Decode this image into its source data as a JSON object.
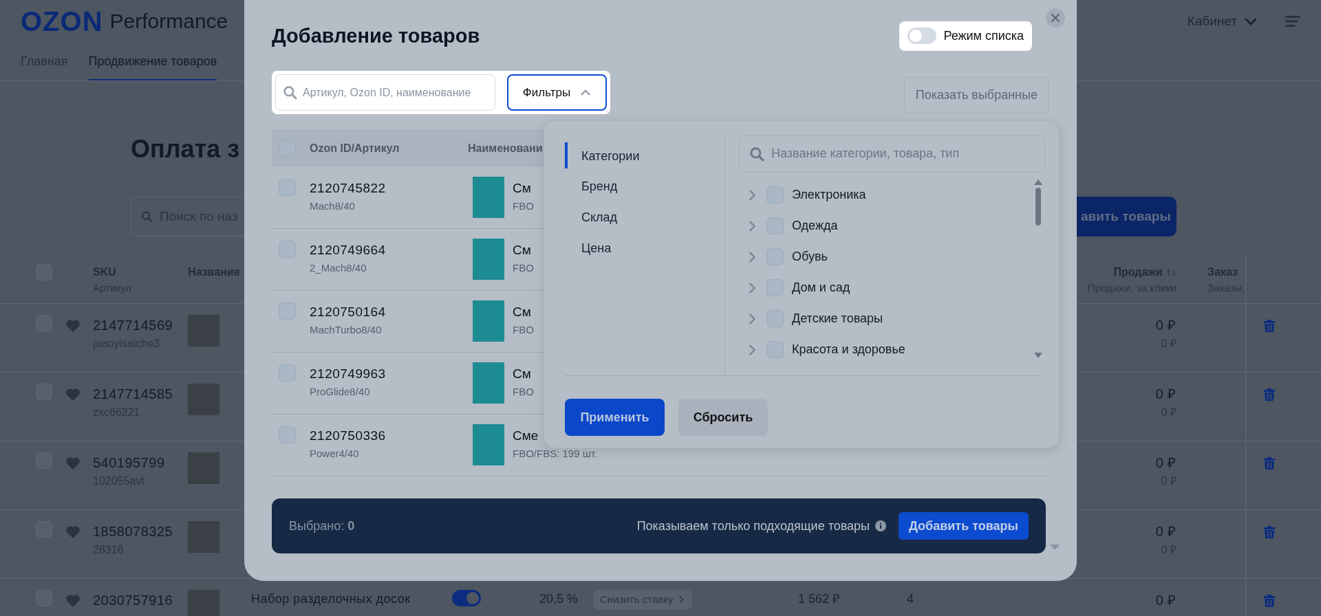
{
  "header": {
    "logo": "OZON",
    "product": "Performance",
    "account": "Кабинет"
  },
  "nav": [
    {
      "label": "Главная",
      "selected": false
    },
    {
      "label": "Продвижение товаров",
      "selected": true
    }
  ],
  "page": {
    "title": "Оплата з",
    "search_placeholder": "Поиск по наз",
    "add_button": "авить товары"
  },
  "campaign_table": {
    "all_checked": false,
    "columns": [
      {
        "title": "SKU",
        "subtitle": "Артикул"
      },
      {
        "title": "Название"
      },
      {
        "title": "Продажи",
        "sort": "↑↓",
        "subtitle": "Продажи, за клики"
      },
      {
        "title": "Заказ",
        "subtitle": "Заказы,"
      }
    ],
    "rows": [
      {
        "checked": false,
        "sku": "2147714569",
        "article": "piaoyisaiche3",
        "sales": "0 ₽",
        "sales_clicks": "0 ₽"
      },
      {
        "checked": false,
        "sku": "2147714585",
        "article": "zxc66221",
        "sales": "0 ₽",
        "sales_clicks": "0 ₽"
      },
      {
        "checked": false,
        "sku": "540195799",
        "article": "102055avt",
        "sales": "0 ₽",
        "sales_clicks": "0 ₽"
      },
      {
        "checked": false,
        "sku": "1858078325",
        "article": "28316",
        "sales": "0 ₽",
        "sales_clicks": "0 ₽"
      },
      {
        "checked": false,
        "sku": "2030757916",
        "name": "Набор разделочных досок",
        "on": true,
        "rate": "20,5 %",
        "bid_action": "Снизить ставку",
        "price": "1 562 ₽",
        "orders": "4",
        "sales": "0 ₽"
      }
    ]
  },
  "modal": {
    "title": "Добавление товаров",
    "list_mode": {
      "label": "Режим списка",
      "on": false
    },
    "search_placeholder": "Артикул, Ozon ID, наименование",
    "filter_button": {
      "label": "Фильтры",
      "expanded": true
    },
    "show_selected": "Показать выбранные",
    "all_checked": false,
    "columns": [
      "Ozon ID/Артикул",
      "Наименовани"
    ],
    "rows": [
      {
        "checked": false,
        "id": "2120745822",
        "article": "Mach8/40",
        "name": "См",
        "stock": "FBO"
      },
      {
        "checked": false,
        "id": "2120749664",
        "article": "2_Mach8/40",
        "name": "См",
        "stock": "FBO"
      },
      {
        "checked": false,
        "id": "2120750164",
        "article": "MachTurbo8/40",
        "name": "См",
        "stock": "FBO"
      },
      {
        "checked": false,
        "id": "2120749963",
        "article": "ProGlide8/40",
        "name": "См",
        "stock": "FBO"
      },
      {
        "checked": false,
        "id": "2120750336",
        "article": "Power4/40",
        "name": "Сме",
        "stock": "FBO/FBS: 199 шт."
      }
    ],
    "filter_panel": {
      "sections": [
        {
          "label": "Категории",
          "selected": true
        },
        {
          "label": "Бренд",
          "selected": false
        },
        {
          "label": "Склад",
          "selected": false
        },
        {
          "label": "Цена",
          "selected": false
        }
      ],
      "search_placeholder": "Название категории, товара, тип",
      "categories": [
        {
          "label": "Электроника",
          "checked": false,
          "expanded": false
        },
        {
          "label": "Одежда",
          "checked": false,
          "expanded": false
        },
        {
          "label": "Обувь",
          "checked": false,
          "expanded": false
        },
        {
          "label": "Дом и сад",
          "checked": false,
          "expanded": false
        },
        {
          "label": "Детские товары",
          "checked": false,
          "expanded": false
        },
        {
          "label": "Красота и здоровье",
          "checked": false,
          "expanded": false
        }
      ],
      "apply": "Применить",
      "reset": "Сбросить"
    },
    "footer": {
      "selected": "Выбрано: **0**",
      "note": "Показываем только подходящие товары",
      "add_button": "Добавить товары"
    }
  }
}
